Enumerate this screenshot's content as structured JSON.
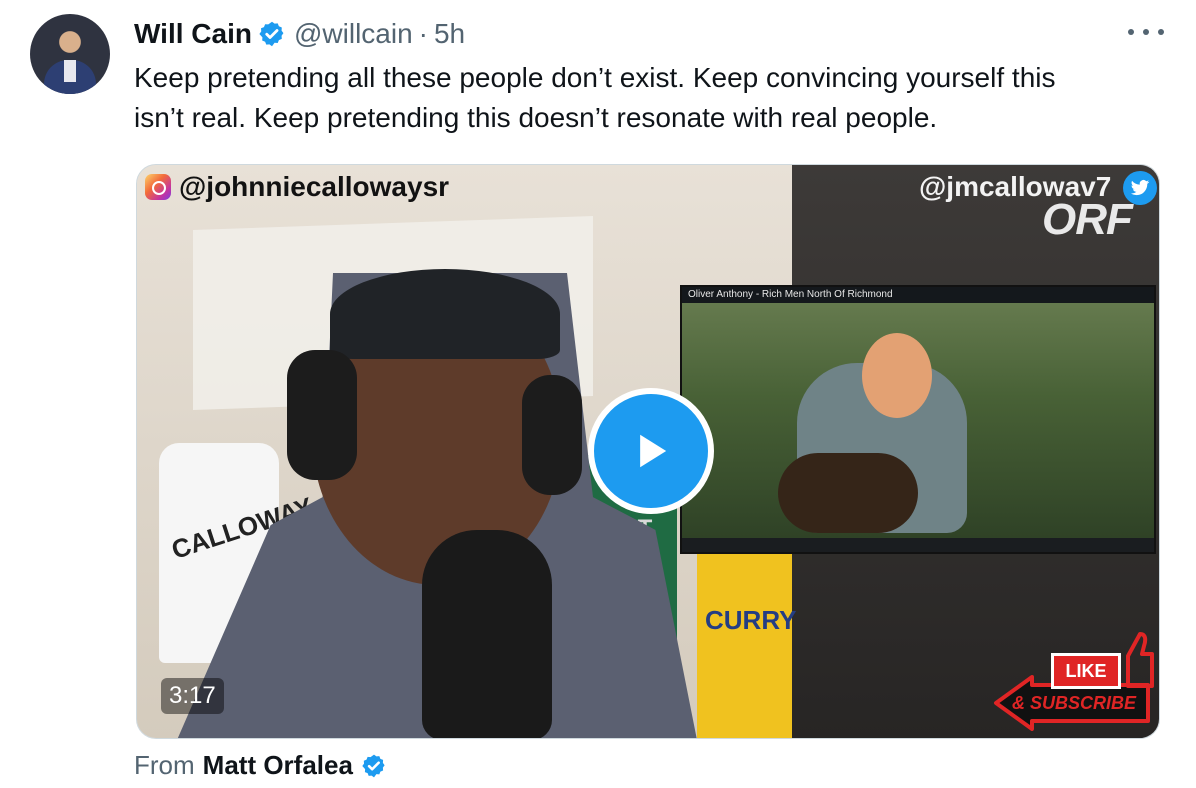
{
  "tweet": {
    "author_name": "Will Cain",
    "handle": "@willcain",
    "separator": "·",
    "time": "5h",
    "text": "Keep pretending all these people don’t exist. Keep convincing yourself this\nisn’t real. Keep pretending this doesn’t resonate with real people."
  },
  "video": {
    "instagram_tag": "@johnniecallowaysr",
    "twitter_tag": "@jmcallowav7",
    "watermark": "ORF",
    "duration": "3:17",
    "jersey_left": "CALLOWAY",
    "jersey_green": "MORANT",
    "jersey_yellow": "CURRY",
    "inset_title": "Oliver Anthony - Rich Men North Of Richmond",
    "like_label": "LIKE",
    "subscribe_label": "& SUBSCRIBE"
  },
  "footer": {
    "from_label": "From",
    "from_name": "Matt Orfalea"
  },
  "colors": {
    "verified_blue": "#1d9bf0",
    "text_primary": "#0f1419",
    "text_secondary": "#536471",
    "accent_red": "#e02525"
  }
}
